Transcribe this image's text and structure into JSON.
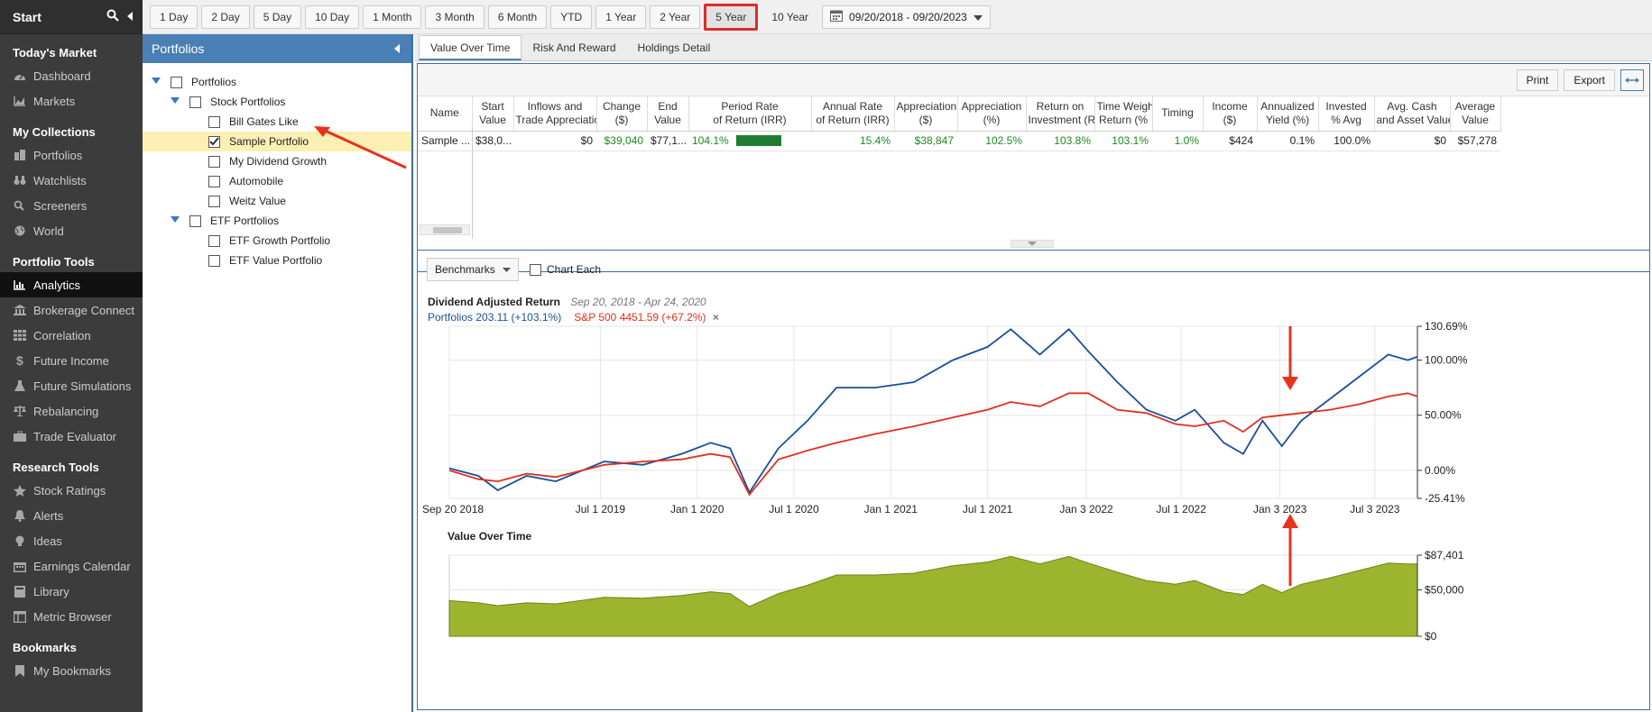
{
  "nav": {
    "start": "Start",
    "sections": [
      {
        "title": "Today's Market",
        "items": [
          {
            "label": "Dashboard",
            "icon": "gauge-icon"
          },
          {
            "label": "Markets",
            "icon": "area-chart-icon"
          }
        ]
      },
      {
        "title": "My Collections",
        "items": [
          {
            "label": "Portfolios",
            "icon": "buildings-icon"
          },
          {
            "label": "Watchlists",
            "icon": "binoculars-icon"
          },
          {
            "label": "Screeners",
            "icon": "search-icon"
          },
          {
            "label": "World",
            "icon": "globe-icon"
          }
        ]
      },
      {
        "title": "Portfolio Tools",
        "items": [
          {
            "label": "Analytics",
            "icon": "bar-chart-icon",
            "active": true
          },
          {
            "label": "Brokerage Connect",
            "icon": "bank-icon"
          },
          {
            "label": "Correlation",
            "icon": "grid-icon"
          },
          {
            "label": "Future Income",
            "icon": "dollar-icon"
          },
          {
            "label": "Future Simulations",
            "icon": "flask-icon"
          },
          {
            "label": "Rebalancing",
            "icon": "scale-icon"
          },
          {
            "label": "Trade Evaluator",
            "icon": "briefcase-icon"
          }
        ]
      },
      {
        "title": "Research Tools",
        "items": [
          {
            "label": "Stock Ratings",
            "icon": "star-icon"
          },
          {
            "label": "Alerts",
            "icon": "bell-icon"
          },
          {
            "label": "Ideas",
            "icon": "lightbulb-icon"
          },
          {
            "label": "Earnings Calendar",
            "icon": "calendar-icon"
          },
          {
            "label": "Library",
            "icon": "book-icon"
          },
          {
            "label": "Metric Browser",
            "icon": "window-icon"
          }
        ]
      },
      {
        "title": "Bookmarks",
        "items": [
          {
            "label": "My Bookmarks",
            "icon": "bookmark-icon"
          }
        ]
      }
    ]
  },
  "toolbar": {
    "ranges": [
      "1 Day",
      "2 Day",
      "5 Day",
      "10 Day",
      "1 Month",
      "3 Month",
      "6 Month",
      "YTD",
      "1 Year",
      "2 Year",
      "5 Year",
      "10 Year"
    ],
    "selected": "5 Year",
    "date_range": "09/20/2018 - 09/20/2023"
  },
  "tree": {
    "header": "Portfolios",
    "rows": [
      {
        "label": "Portfolios",
        "level": 0,
        "expandable": true,
        "checked": false
      },
      {
        "label": "Stock Portfolios",
        "level": 1,
        "expandable": true,
        "checked": false
      },
      {
        "label": "Bill Gates Like",
        "level": 2,
        "checked": false
      },
      {
        "label": "Sample Portfolio",
        "level": 2,
        "checked": true,
        "selected": true
      },
      {
        "label": "My Dividend Growth",
        "level": 2,
        "checked": false
      },
      {
        "label": "Automobile",
        "level": 2,
        "checked": false
      },
      {
        "label": "Weitz Value",
        "level": 2,
        "checked": false
      },
      {
        "label": "ETF Portfolios",
        "level": 1,
        "expandable": true,
        "checked": false
      },
      {
        "label": "ETF Growth Portfolio",
        "level": 2,
        "checked": false
      },
      {
        "label": "ETF Value Portfolio",
        "level": 2,
        "checked": false
      }
    ]
  },
  "tabs": [
    "Value Over Time",
    "Risk And Reward",
    "Holdings Detail"
  ],
  "tools": {
    "print": "Print",
    "export": "Export"
  },
  "table": {
    "headers": [
      [
        "Name"
      ],
      [
        "Start",
        "Value"
      ],
      [
        "Inflows and",
        "Trade Appreciation"
      ],
      [
        "Change",
        "($)"
      ],
      [
        "End",
        "Value"
      ],
      [
        "Period Rate",
        "of Return (IRR)"
      ],
      [
        "Annual Rate",
        "of Return (IRR)"
      ],
      [
        "Appreciation",
        "($)"
      ],
      [
        "Appreciation",
        "(%)"
      ],
      [
        "Return on",
        "Investment (R"
      ],
      [
        "Time Weigh",
        "Return (%"
      ],
      [
        "Timing"
      ],
      [
        "Income",
        "($)"
      ],
      [
        "Annualized",
        "Yield (%)"
      ],
      [
        "Invested",
        "% Avg"
      ],
      [
        "Avg. Cash",
        "and Asset Value"
      ],
      [
        "Average",
        "Value"
      ]
    ],
    "row": [
      "Sample ...",
      "$38,0...",
      "$0",
      "$39,040",
      "$77,1...",
      "104.1%",
      "15.4%",
      "$38,847",
      "102.5%",
      "103.8%",
      "103.1%",
      "1.0%",
      "$424",
      "0.1%",
      "100.0%",
      "$0",
      "$57,278"
    ]
  },
  "chart_panel": {
    "benchmarks": "Benchmarks",
    "chart_each": "Chart Each",
    "title": "Dividend Adjusted Return",
    "period": "Sep 20, 2018 - Apr 24, 2020",
    "legend_portfolio": "Portfolios 203.11 (+103.1%)",
    "legend_sp": "S&P 500 4451.59 (+67.2%)",
    "legend_close": "×",
    "value_title": "Value Over Time",
    "colors": {
      "portfolio": "#1a4f9c",
      "sp500": "#e0301e",
      "area": "#9db52e"
    }
  },
  "chart_data": [
    {
      "type": "line",
      "title": "Dividend Adjusted Return",
      "ylim": [
        -25.41,
        130.69
      ],
      "y_tick_labels": [
        "130.69%",
        "100.00%",
        "50.00%",
        "0.00%",
        "-25.41%"
      ],
      "y_ticks": [
        130.69,
        100,
        50,
        0,
        -25.41
      ],
      "x_tick_labels": [
        "Sep 20 2018",
        "Jul 1 2019",
        "Jan 1 2020",
        "Jul 1 2020",
        "Jan 1 2021",
        "Jul 1 2021",
        "Jan 3 2022",
        "Jul 1 2022",
        "Jan 3 2023",
        "Jul 3 2023"
      ],
      "x_tick_pos": [
        0,
        0.78,
        1.28,
        1.78,
        2.28,
        2.78,
        3.29,
        3.78,
        4.29,
        4.78
      ],
      "x_range": [
        0,
        5.0
      ],
      "series": [
        {
          "name": "Portfolios",
          "x": [
            0,
            0.15,
            0.25,
            0.4,
            0.55,
            0.8,
            1.0,
            1.2,
            1.35,
            1.45,
            1.55,
            1.7,
            1.85,
            2.0,
            2.2,
            2.4,
            2.6,
            2.78,
            2.9,
            3.05,
            3.2,
            3.3,
            3.45,
            3.6,
            3.75,
            3.85,
            4.0,
            4.1,
            4.2,
            4.3,
            4.4,
            4.55,
            4.7,
            4.85,
            4.95,
            5.0
          ],
          "y": [
            2,
            -5,
            -18,
            -5,
            -10,
            8,
            5,
            15,
            25,
            20,
            -20,
            20,
            45,
            75,
            75,
            80,
            100,
            112,
            128,
            105,
            128,
            108,
            80,
            55,
            45,
            55,
            25,
            15,
            45,
            22,
            45,
            65,
            85,
            105,
            100,
            103
          ]
        },
        {
          "name": "S&P 500",
          "x": [
            0,
            0.15,
            0.25,
            0.4,
            0.55,
            0.8,
            1.0,
            1.2,
            1.35,
            1.45,
            1.55,
            1.7,
            1.85,
            2.0,
            2.2,
            2.4,
            2.6,
            2.78,
            2.9,
            3.05,
            3.2,
            3.3,
            3.45,
            3.6,
            3.75,
            3.85,
            4.0,
            4.1,
            4.2,
            4.3,
            4.4,
            4.55,
            4.7,
            4.85,
            4.95,
            5.0
          ],
          "y": [
            0,
            -8,
            -10,
            -3,
            -6,
            5,
            8,
            10,
            15,
            12,
            -22,
            10,
            18,
            25,
            33,
            40,
            48,
            55,
            62,
            58,
            70,
            70,
            55,
            52,
            42,
            40,
            45,
            35,
            48,
            50,
            52,
            55,
            60,
            67,
            70,
            67
          ]
        }
      ]
    },
    {
      "type": "area",
      "title": "Value Over Time",
      "ylim": [
        0,
        87401
      ],
      "y_tick_labels": [
        "$87,401",
        "$50,000",
        "$0"
      ],
      "y_ticks": [
        87401,
        50000,
        0
      ],
      "x_range": [
        0,
        5.0
      ],
      "series": [
        {
          "name": "Value",
          "x": [
            0,
            0.15,
            0.25,
            0.4,
            0.55,
            0.8,
            1.0,
            1.2,
            1.35,
            1.45,
            1.55,
            1.7,
            1.85,
            2.0,
            2.2,
            2.4,
            2.6,
            2.78,
            2.9,
            3.05,
            3.2,
            3.3,
            3.45,
            3.6,
            3.75,
            3.85,
            4.0,
            4.1,
            4.2,
            4.3,
            4.4,
            4.55,
            4.7,
            4.85,
            4.95,
            5.0
          ],
          "y": [
            38500,
            36000,
            33000,
            36000,
            35000,
            42000,
            41000,
            44000,
            48000,
            46000,
            32000,
            46000,
            55000,
            66000,
            66000,
            68000,
            76000,
            80000,
            86000,
            78000,
            86000,
            79000,
            69000,
            60000,
            56000,
            60000,
            48000,
            45000,
            56000,
            47000,
            56000,
            63000,
            71000,
            79000,
            78000,
            78000
          ]
        }
      ]
    }
  ]
}
